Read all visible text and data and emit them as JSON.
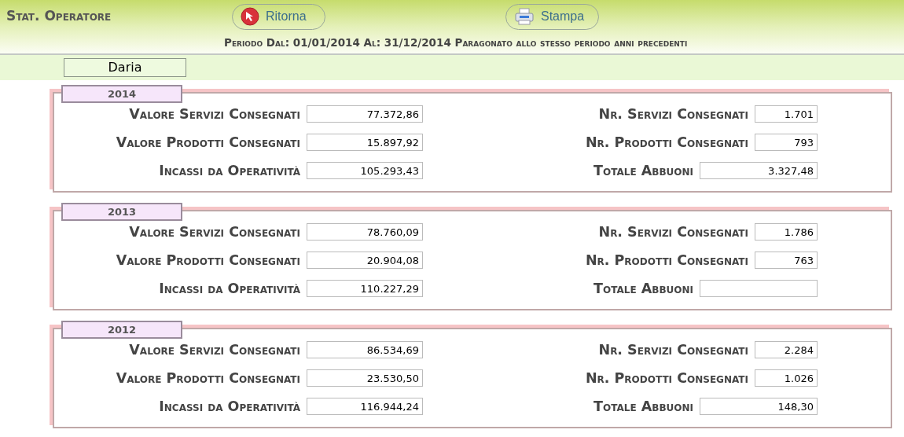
{
  "title": "Stat. Operatore",
  "buttons": [
    {
      "label": "Ritorna",
      "kind": "back"
    },
    {
      "label": "Stampa",
      "kind": "print"
    }
  ],
  "period": "Periodo Dal: 01/01/2014 Al: 31/12/2014 Paragonato allo stesso periodo anni precedenti",
  "operator": "Daria",
  "years": [
    {
      "year": "2014",
      "left": [
        {
          "label": "Valore Servizi Consegnati",
          "value": "77.372,86"
        },
        {
          "label": "Valore Prodotti Consegnati",
          "value": "15.897,92"
        },
        {
          "label": "Incassi da Operatività",
          "value": "105.293,43"
        }
      ],
      "right": [
        {
          "label": "Nr. Servizi Consegnati",
          "value": "1.701",
          "kind": "count"
        },
        {
          "label": "Nr. Prodotti Consegnati",
          "value": "793",
          "kind": "count"
        },
        {
          "label": "Totale Abbuoni",
          "value": "3.327,48",
          "kind": "amount"
        }
      ]
    },
    {
      "year": "2013",
      "left": [
        {
          "label": "Valore Servizi Consegnati",
          "value": "78.760,09"
        },
        {
          "label": "Valore Prodotti Consegnati",
          "value": "20.904,08"
        },
        {
          "label": "Incassi da Operatività",
          "value": "110.227,29"
        }
      ],
      "right": [
        {
          "label": "Nr. Servizi Consegnati",
          "value": "1.786",
          "kind": "count"
        },
        {
          "label": "Nr. Prodotti Consegnati",
          "value": "763",
          "kind": "count"
        },
        {
          "label": "Totale Abbuoni",
          "kind": "amount"
        }
      ]
    },
    {
      "year": "2012",
      "left": [
        {
          "label": "Valore Servizi Consegnati",
          "value": "86.534,69"
        },
        {
          "label": "Valore Prodotti Consegnati",
          "value": "23.530,50"
        },
        {
          "label": "Incassi da Operatività",
          "value": "116.944,24"
        }
      ],
      "right": [
        {
          "label": "Nr. Servizi Consegnati",
          "value": "2.284",
          "kind": "count"
        },
        {
          "label": "Nr. Prodotti Consegnati",
          "value": "1.026",
          "kind": "count"
        },
        {
          "label": "Totale Abbuoni",
          "value": "148,30",
          "kind": "amount"
        }
      ]
    }
  ]
}
